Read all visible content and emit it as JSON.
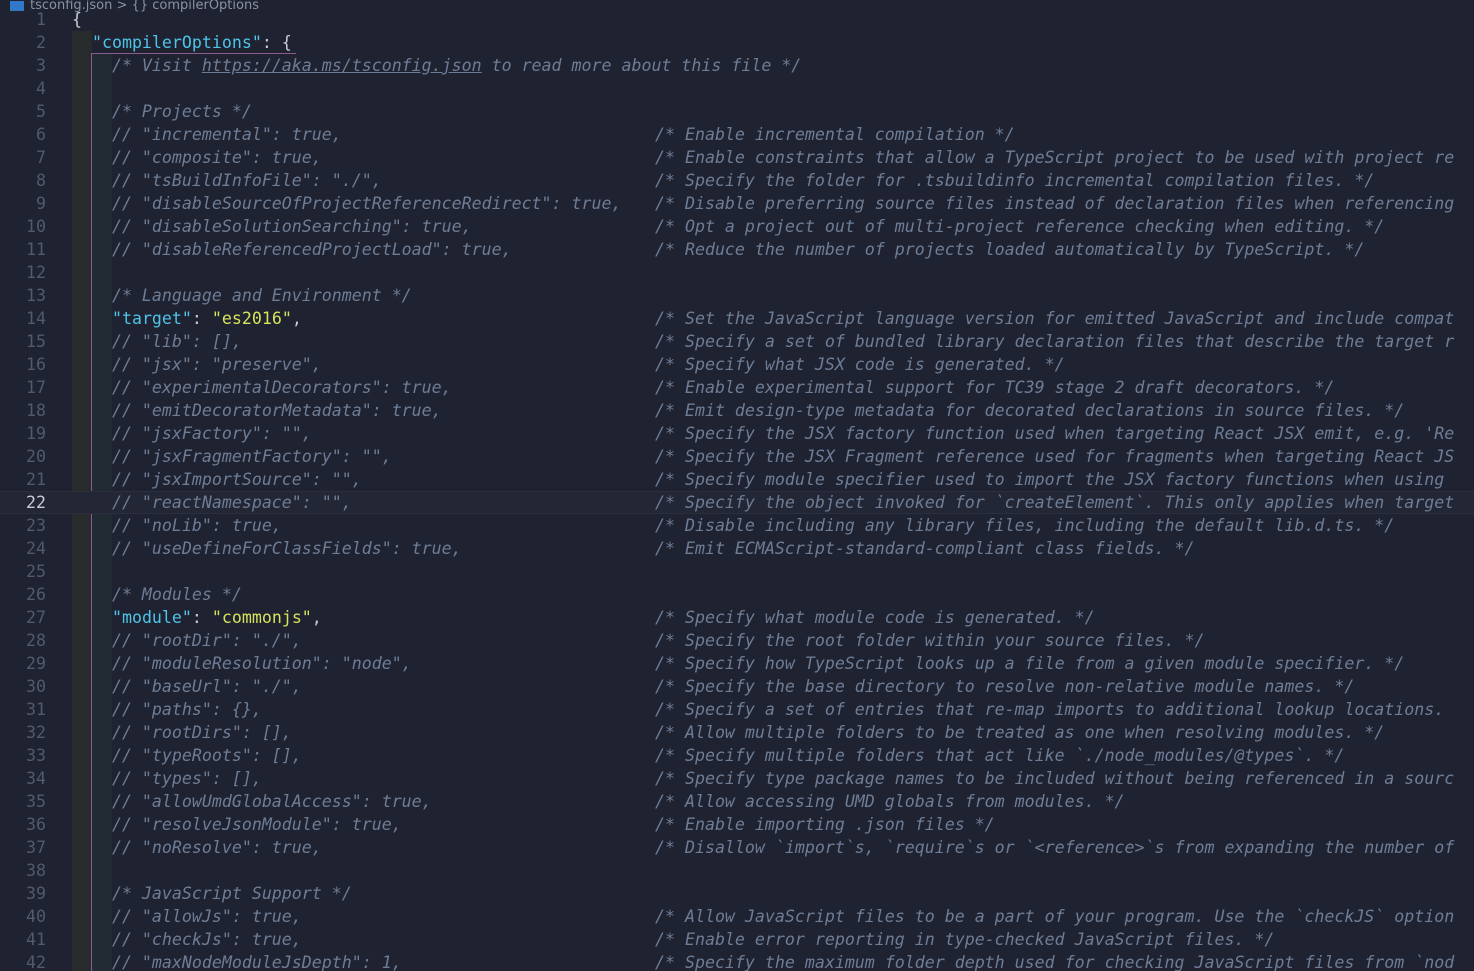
{
  "breadcrumb": {
    "file": "tsconfig.json",
    "separator": ">",
    "symbol": "{} compilerOptions"
  },
  "active_line": 22,
  "colors": {
    "background": "#1f2230",
    "key": "#4fc3e8",
    "string": "#d7e35a",
    "comment": "#6e7d96",
    "punct": "#c8ccd4"
  },
  "lines": [
    {
      "n": 1,
      "c": [
        [
          "p",
          "{"
        ]
      ]
    },
    {
      "n": 2,
      "c": [
        [
          "p",
          "  "
        ],
        [
          "k",
          "\"compilerOptions\""
        ],
        [
          "p",
          ": {"
        ]
      ]
    },
    {
      "n": 3,
      "c": [
        [
          "m",
          "    /* Visit "
        ],
        [
          "mu",
          "https://aka.ms/tsconfig.json"
        ],
        [
          "m",
          " to read more about this file */"
        ]
      ]
    },
    {
      "n": 4,
      "c": []
    },
    {
      "n": 5,
      "c": [
        [
          "m",
          "    /* Projects */"
        ]
      ]
    },
    {
      "n": 6,
      "c": [
        [
          "m",
          "    // \"incremental\": true,"
        ]
      ],
      "r": "/* Enable incremental compilation */"
    },
    {
      "n": 7,
      "c": [
        [
          "m",
          "    // \"composite\": true,"
        ]
      ],
      "r": "/* Enable constraints that allow a TypeScript project to be used with project re"
    },
    {
      "n": 8,
      "c": [
        [
          "m",
          "    // \"tsBuildInfoFile\": \"./\","
        ]
      ],
      "r": "/* Specify the folder for .tsbuildinfo incremental compilation files. */"
    },
    {
      "n": 9,
      "c": [
        [
          "m",
          "    // \"disableSourceOfProjectReferenceRedirect\": true,"
        ]
      ],
      "r": "/* Disable preferring source files instead of declaration files when referencing"
    },
    {
      "n": 10,
      "c": [
        [
          "m",
          "    // \"disableSolutionSearching\": true,"
        ]
      ],
      "r": "/* Opt a project out of multi-project reference checking when editing. */"
    },
    {
      "n": 11,
      "c": [
        [
          "m",
          "    // \"disableReferencedProjectLoad\": true,"
        ]
      ],
      "r": "/* Reduce the number of projects loaded automatically by TypeScript. */"
    },
    {
      "n": 12,
      "c": []
    },
    {
      "n": 13,
      "c": [
        [
          "m",
          "    /* Language and Environment */"
        ]
      ]
    },
    {
      "n": 14,
      "c": [
        [
          "p",
          "    "
        ],
        [
          "k",
          "\"target\""
        ],
        [
          "p",
          ": "
        ],
        [
          "s",
          "\"es2016\""
        ],
        [
          "p",
          ","
        ]
      ],
      "r": "/* Set the JavaScript language version for emitted JavaScript and include compat"
    },
    {
      "n": 15,
      "c": [
        [
          "m",
          "    // \"lib\": [],"
        ]
      ],
      "r": "/* Specify a set of bundled library declaration files that describe the target r"
    },
    {
      "n": 16,
      "c": [
        [
          "m",
          "    // \"jsx\": \"preserve\","
        ]
      ],
      "r": "/* Specify what JSX code is generated. */"
    },
    {
      "n": 17,
      "c": [
        [
          "m",
          "    // \"experimentalDecorators\": true,"
        ]
      ],
      "r": "/* Enable experimental support for TC39 stage 2 draft decorators. */"
    },
    {
      "n": 18,
      "c": [
        [
          "m",
          "    // \"emitDecoratorMetadata\": true,"
        ]
      ],
      "r": "/* Emit design-type metadata for decorated declarations in source files. */"
    },
    {
      "n": 19,
      "c": [
        [
          "m",
          "    // \"jsxFactory\": \"\","
        ]
      ],
      "r": "/* Specify the JSX factory function used when targeting React JSX emit, e.g. 'Re"
    },
    {
      "n": 20,
      "c": [
        [
          "m",
          "    // \"jsxFragmentFactory\": \"\","
        ]
      ],
      "r": "/* Specify the JSX Fragment reference used for fragments when targeting React JS"
    },
    {
      "n": 21,
      "c": [
        [
          "m",
          "    // \"jsxImportSource\": \"\","
        ]
      ],
      "r": "/* Specify module specifier used to import the JSX factory functions when using "
    },
    {
      "n": 22,
      "c": [
        [
          "m",
          "    // \"reactNamespace\": \"\","
        ]
      ],
      "r": "/* Specify the object invoked for `createElement`. This only applies when target"
    },
    {
      "n": 23,
      "c": [
        [
          "m",
          "    // \"noLib\": true,"
        ]
      ],
      "r": "/* Disable including any library files, including the default lib.d.ts. */"
    },
    {
      "n": 24,
      "c": [
        [
          "m",
          "    // \"useDefineForClassFields\": true,"
        ]
      ],
      "r": "/* Emit ECMAScript-standard-compliant class fields. */"
    },
    {
      "n": 25,
      "c": []
    },
    {
      "n": 26,
      "c": [
        [
          "m",
          "    /* Modules */"
        ]
      ]
    },
    {
      "n": 27,
      "c": [
        [
          "p",
          "    "
        ],
        [
          "k",
          "\"module\""
        ],
        [
          "p",
          ": "
        ],
        [
          "s",
          "\"commonjs\""
        ],
        [
          "p",
          ","
        ]
      ],
      "r": "/* Specify what module code is generated. */"
    },
    {
      "n": 28,
      "c": [
        [
          "m",
          "    // \"rootDir\": \"./\","
        ]
      ],
      "r": "/* Specify the root folder within your source files. */"
    },
    {
      "n": 29,
      "c": [
        [
          "m",
          "    // \"moduleResolution\": \"node\","
        ]
      ],
      "r": "/* Specify how TypeScript looks up a file from a given module specifier. */"
    },
    {
      "n": 30,
      "c": [
        [
          "m",
          "    // \"baseUrl\": \"./\","
        ]
      ],
      "r": "/* Specify the base directory to resolve non-relative module names. */"
    },
    {
      "n": 31,
      "c": [
        [
          "m",
          "    // \"paths\": {},"
        ]
      ],
      "r": "/* Specify a set of entries that re-map imports to additional lookup locations. "
    },
    {
      "n": 32,
      "c": [
        [
          "m",
          "    // \"rootDirs\": [],"
        ]
      ],
      "r": "/* Allow multiple folders to be treated as one when resolving modules. */"
    },
    {
      "n": 33,
      "c": [
        [
          "m",
          "    // \"typeRoots\": [],"
        ]
      ],
      "r": "/* Specify multiple folders that act like `./node_modules/@types`. */"
    },
    {
      "n": 34,
      "c": [
        [
          "m",
          "    // \"types\": [],"
        ]
      ],
      "r": "/* Specify type package names to be included without being referenced in a sourc"
    },
    {
      "n": 35,
      "c": [
        [
          "m",
          "    // \"allowUmdGlobalAccess\": true,"
        ]
      ],
      "r": "/* Allow accessing UMD globals from modules. */"
    },
    {
      "n": 36,
      "c": [
        [
          "m",
          "    // \"resolveJsonModule\": true,"
        ]
      ],
      "r": "/* Enable importing .json files */"
    },
    {
      "n": 37,
      "c": [
        [
          "m",
          "    // \"noResolve\": true,"
        ]
      ],
      "r": "/* Disallow `import`s, `require`s or `<reference>`s from expanding the number of "
    },
    {
      "n": 38,
      "c": []
    },
    {
      "n": 39,
      "c": [
        [
          "m",
          "    /* JavaScript Support */"
        ]
      ]
    },
    {
      "n": 40,
      "c": [
        [
          "m",
          "    // \"allowJs\": true,"
        ]
      ],
      "r": "/* Allow JavaScript files to be a part of your program. Use the `checkJS` option "
    },
    {
      "n": 41,
      "c": [
        [
          "m",
          "    // \"checkJs\": true,"
        ]
      ],
      "r": "/* Enable error reporting in type-checked JavaScript files. */"
    },
    {
      "n": 42,
      "c": [
        [
          "m",
          "    // \"maxNodeModuleJsDepth\": 1,"
        ]
      ],
      "r": "/* Specify the maximum folder depth used for checking JavaScript files from `nod"
    }
  ]
}
